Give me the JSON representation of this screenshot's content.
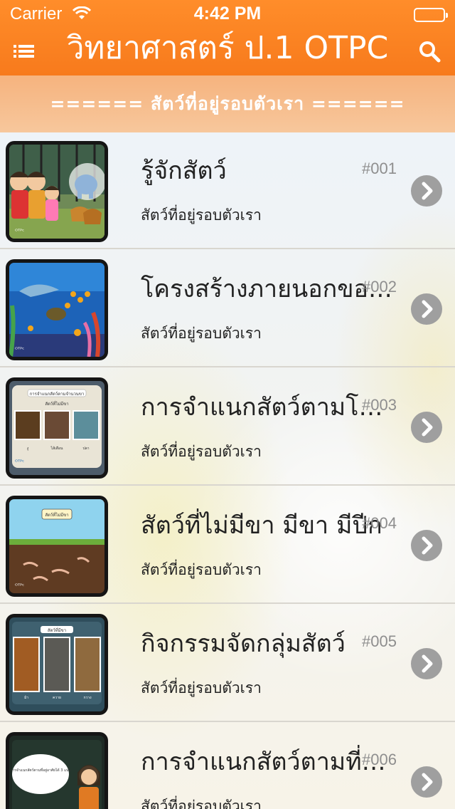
{
  "status": {
    "carrier": "Carrier",
    "time": "4:42 PM"
  },
  "header": {
    "title": "วิทยาศาสตร์ ป.1 OTPC",
    "menu_icon": "list-menu-icon",
    "search_icon": "search-icon"
  },
  "section": {
    "title": "====== สัตว์ที่อยู่รอบตัวเรา ======"
  },
  "colors": {
    "header": "#f77a1c",
    "banner": "#f7c79c",
    "chevron": "#9f9f9f"
  },
  "lessons": [
    {
      "title": "รู้จักสัตว์",
      "number": "#001",
      "subtitle": "สัตว์ที่อยู่รอบตัวเรา"
    },
    {
      "title": "โครงสร้างภายนอกของสัตว์",
      "number": "#002",
      "subtitle": "สัตว์ที่อยู่รอบตัวเรา"
    },
    {
      "title": "การจำแนกสัตว์ตามโครงสร้าง",
      "number": "#003",
      "subtitle": "สัตว์ที่อยู่รอบตัวเรา"
    },
    {
      "title": "สัตว์ที่ไม่มีขา มีขา มีปีก",
      "number": "#004",
      "subtitle": "สัตว์ที่อยู่รอบตัวเรา"
    },
    {
      "title": "กิจกรรมจัดกลุ่มสัตว์",
      "number": "#005",
      "subtitle": "สัตว์ที่อยู่รอบตัวเรา"
    },
    {
      "title": "การจำแนกสัตว์ตามที่อยู่อาศัย",
      "number": "#006",
      "subtitle": "สัตว์ที่อยู่รอบตัวเรา"
    }
  ],
  "thumb_text": {
    "t3_header": "การจำแนกสัตว์ตามจำนวนขา",
    "t3_sub": "สัตว์ที่ไม่มีขา",
    "t3_labels": [
      "งู",
      "ไส้เดือน",
      "ปลา"
    ],
    "t4_header": "สัตว์ที่ไม่มีขา",
    "t5_header": "สัตว์ที่มีขา",
    "t5_labels": [
      "ม้า",
      "ควาย",
      "กวาง"
    ],
    "t6_bubble": "การจำแนกสัตว์ตามที่อยู่อาศัยได้ 3 แบบ",
    "logo": "OTPC"
  }
}
